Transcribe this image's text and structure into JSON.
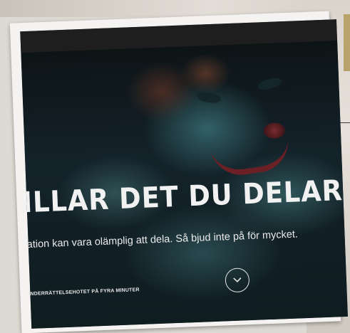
{
  "hero": {
    "headline": "ILLAR DET DU DELAR",
    "subtitle": "ation kan vara olämplig att dela. Så bjud inte på för mycket.",
    "footnote": "NDERRÄTTELSEHOTET PÅ FYRA MINUTER"
  },
  "icons": {
    "scroll": "chevron-down-icon"
  }
}
